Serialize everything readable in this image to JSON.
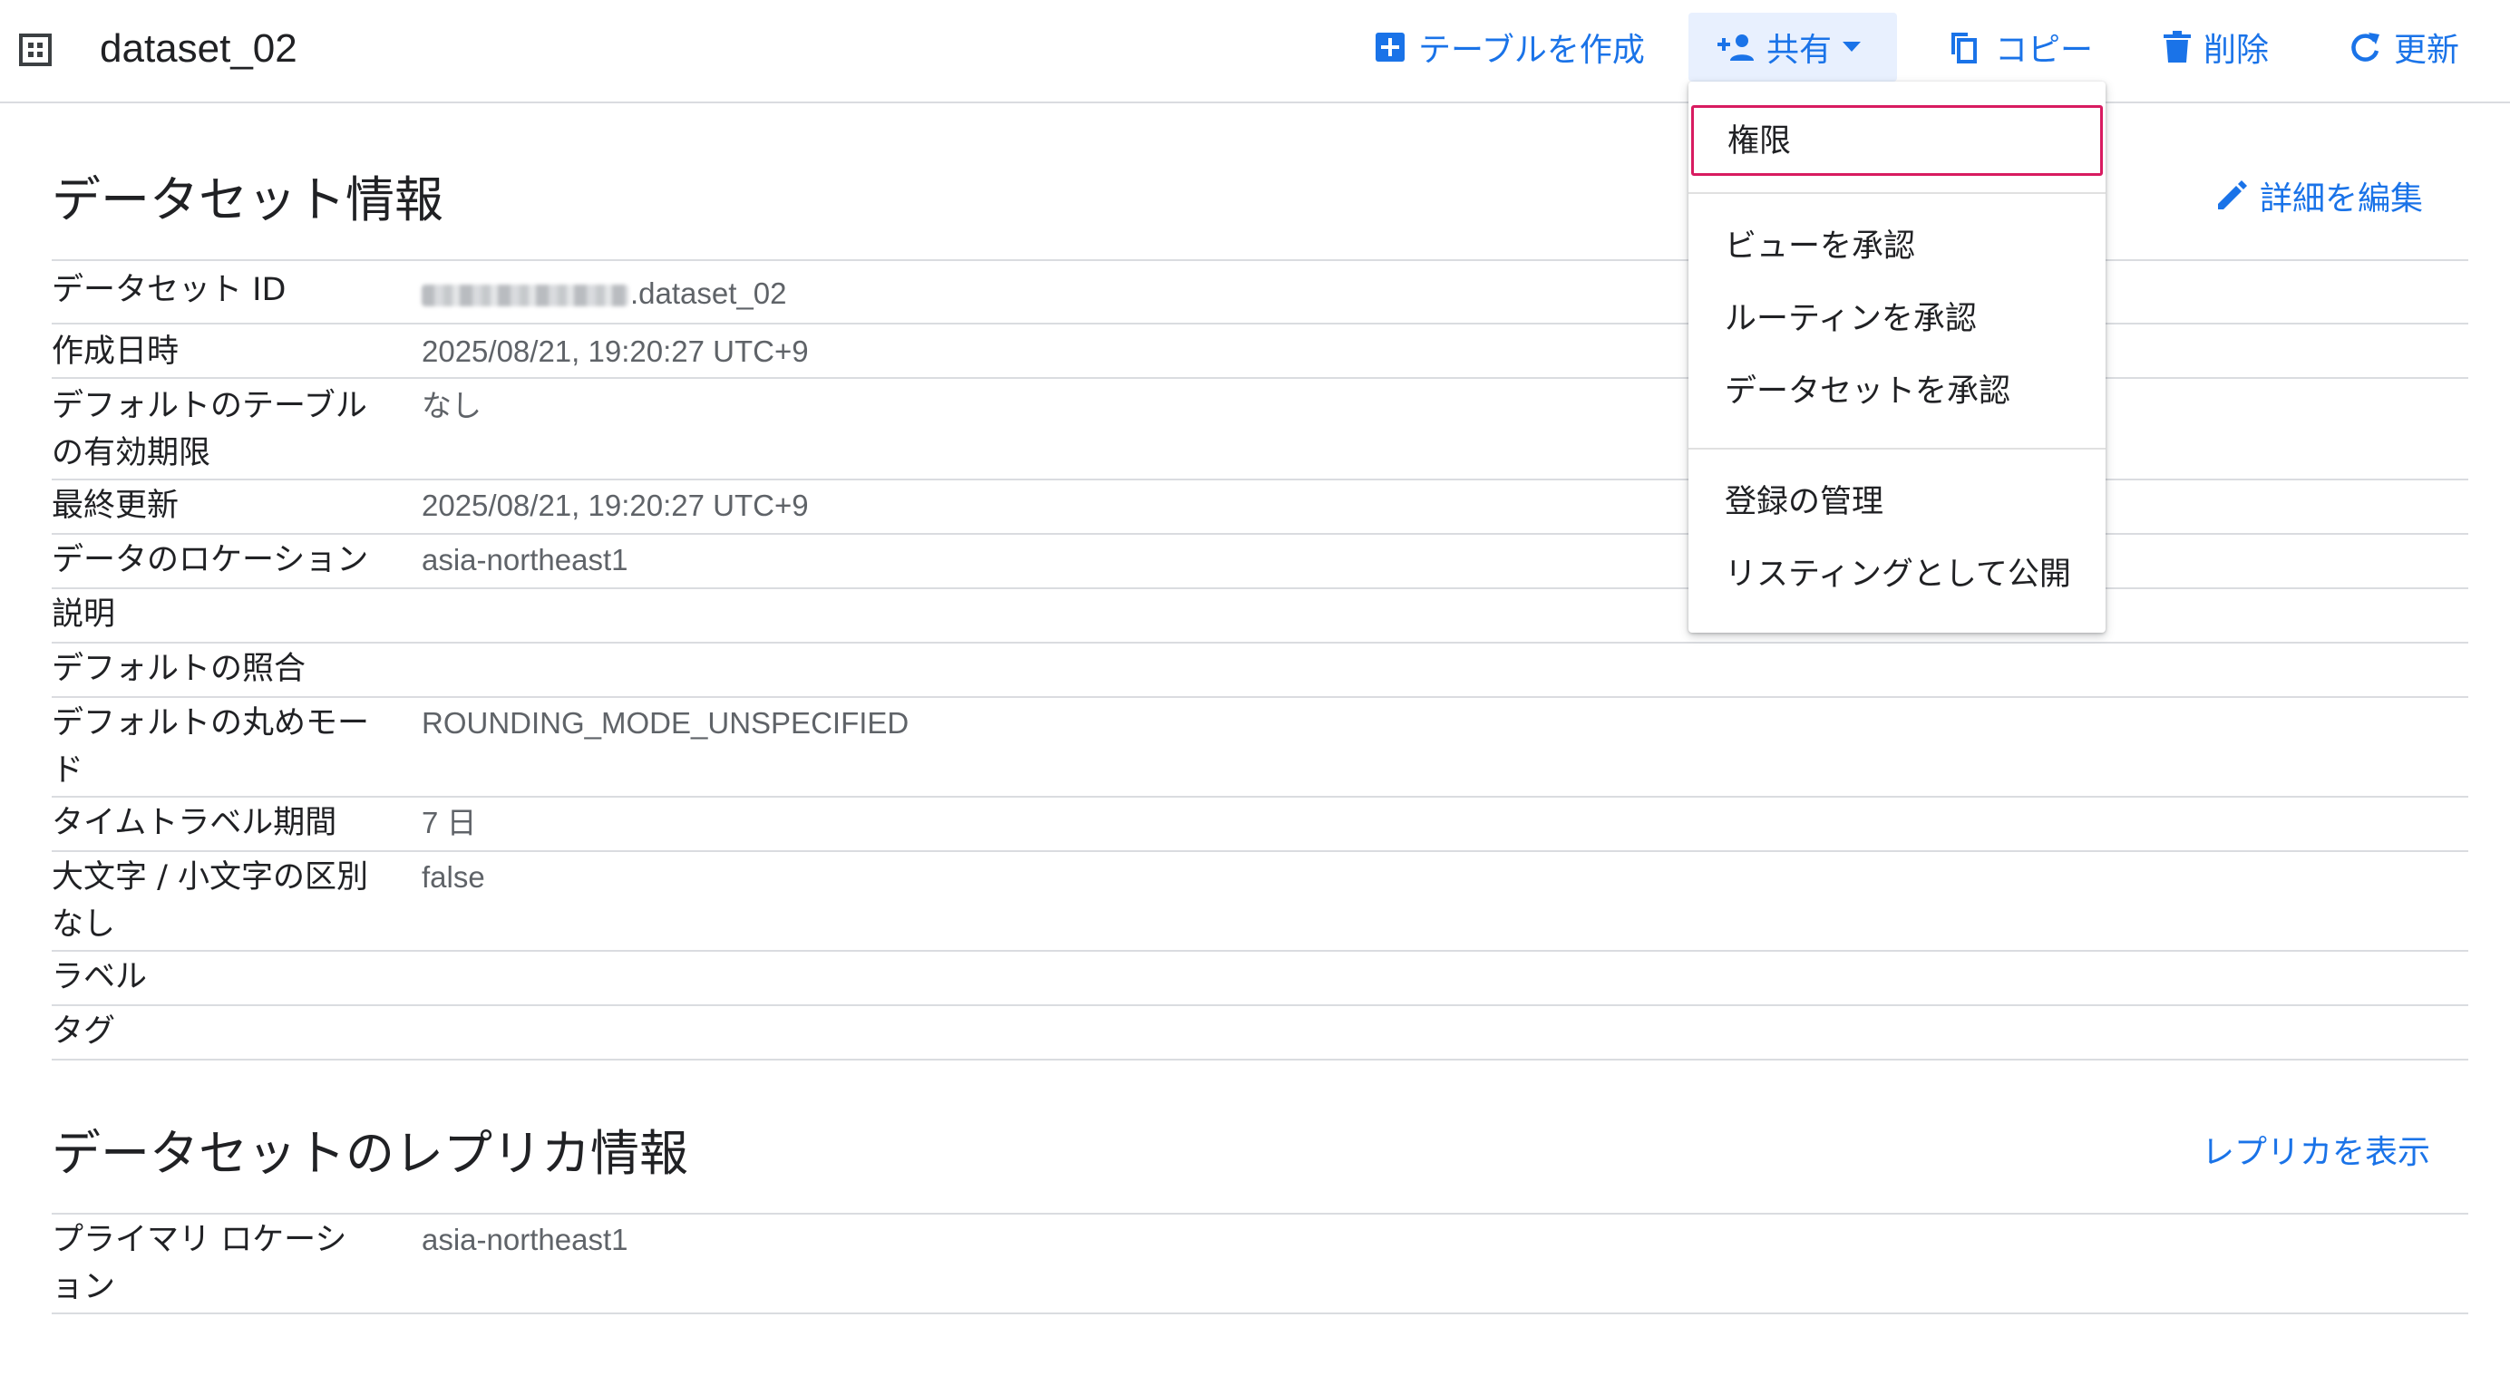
{
  "header": {
    "title": "dataset_02",
    "actions": {
      "create_table": "テーブルを作成",
      "share": "共有",
      "copy": "コピー",
      "delete": "削除",
      "refresh": "更新"
    }
  },
  "share_menu": {
    "items": [
      "権限",
      "ビューを承認",
      "ルーティンを承認",
      "データセットを承認",
      "登録の管理",
      "リスティングとして公開"
    ],
    "focused_item": "権限"
  },
  "dataset_info": {
    "title": "データセット情報",
    "edit_label": "詳細を編集",
    "rows": [
      {
        "label": "データセット ID",
        "value": ".dataset_02"
      },
      {
        "label": "作成日時",
        "value": "2025/08/21, 19:20:27 UTC+9"
      },
      {
        "label": "デフォルトのテーブルの有効期限",
        "value": "なし"
      },
      {
        "label": "最終更新",
        "value": "2025/08/21, 19:20:27 UTC+9"
      },
      {
        "label": "データのロケーション",
        "value": "asia-northeast1"
      },
      {
        "label": "説明",
        "value": ""
      },
      {
        "label": "デフォルトの照合",
        "value": ""
      },
      {
        "label": "デフォルトの丸めモード",
        "value": "ROUNDING_MODE_UNSPECIFIED"
      },
      {
        "label": "タイムトラベル期間",
        "value": "7 日"
      },
      {
        "label": "大文字 / 小文字の区別なし",
        "value": "false"
      },
      {
        "label": "ラベル",
        "value": ""
      },
      {
        "label": "タグ",
        "value": ""
      }
    ]
  },
  "replica_info": {
    "title": "データセットのレプリカ情報",
    "view_label": "レプリカを表示",
    "rows": [
      {
        "label": "プライマリ ロケーション",
        "value": "asia-northeast1"
      }
    ]
  },
  "colors": {
    "accent": "#1a73e8",
    "text": "#202124",
    "secondary_text": "#5f6368",
    "divider": "#dadce0",
    "focus_ring": "#d81b60",
    "active_button_bg": "#e8f0fe"
  },
  "icons": {
    "dataset": "dataset-grid-icon",
    "create_table": "add-box-icon",
    "share": "person-add-icon",
    "copy": "copy-icon",
    "delete": "trash-icon",
    "refresh": "refresh-icon",
    "edit": "pencil-icon"
  }
}
